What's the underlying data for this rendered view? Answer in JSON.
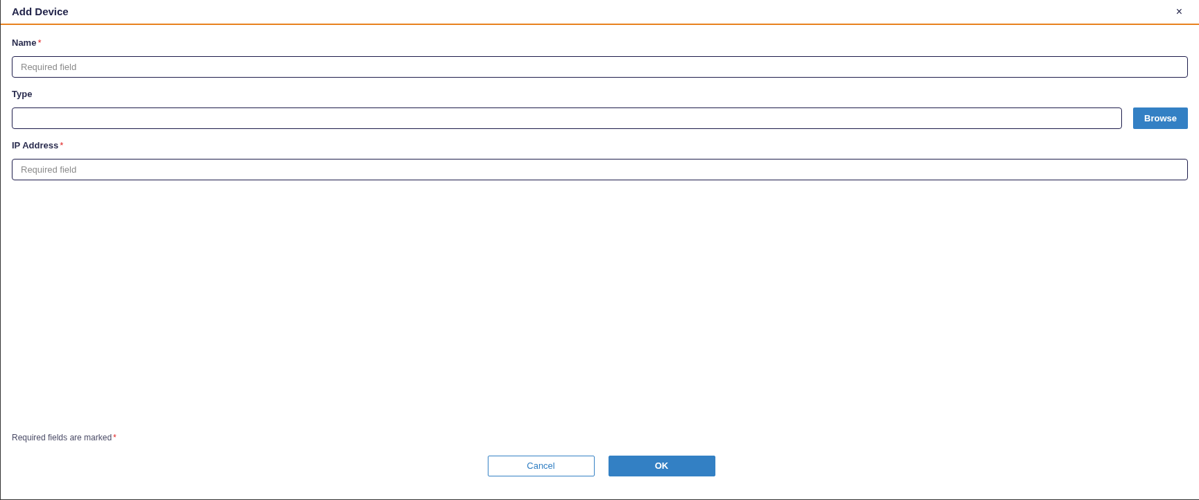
{
  "dialog": {
    "title": "Add Device",
    "close": "×"
  },
  "fields": [
    {
      "label": "Name",
      "required_marker": "*",
      "placeholder": "Required field",
      "kind": "text"
    },
    {
      "label": "Type",
      "kind": "browse",
      "button": "Browse"
    },
    {
      "label": "IP Address",
      "required_marker": "*",
      "placeholder": "Required field",
      "kind": "text"
    }
  ],
  "footer": {
    "note": "Required fields are marked",
    "note_marker": "*",
    "buttons": [
      {
        "label": "Cancel",
        "kind": "secondary"
      },
      {
        "label": "OK",
        "kind": "primary"
      }
    ]
  }
}
